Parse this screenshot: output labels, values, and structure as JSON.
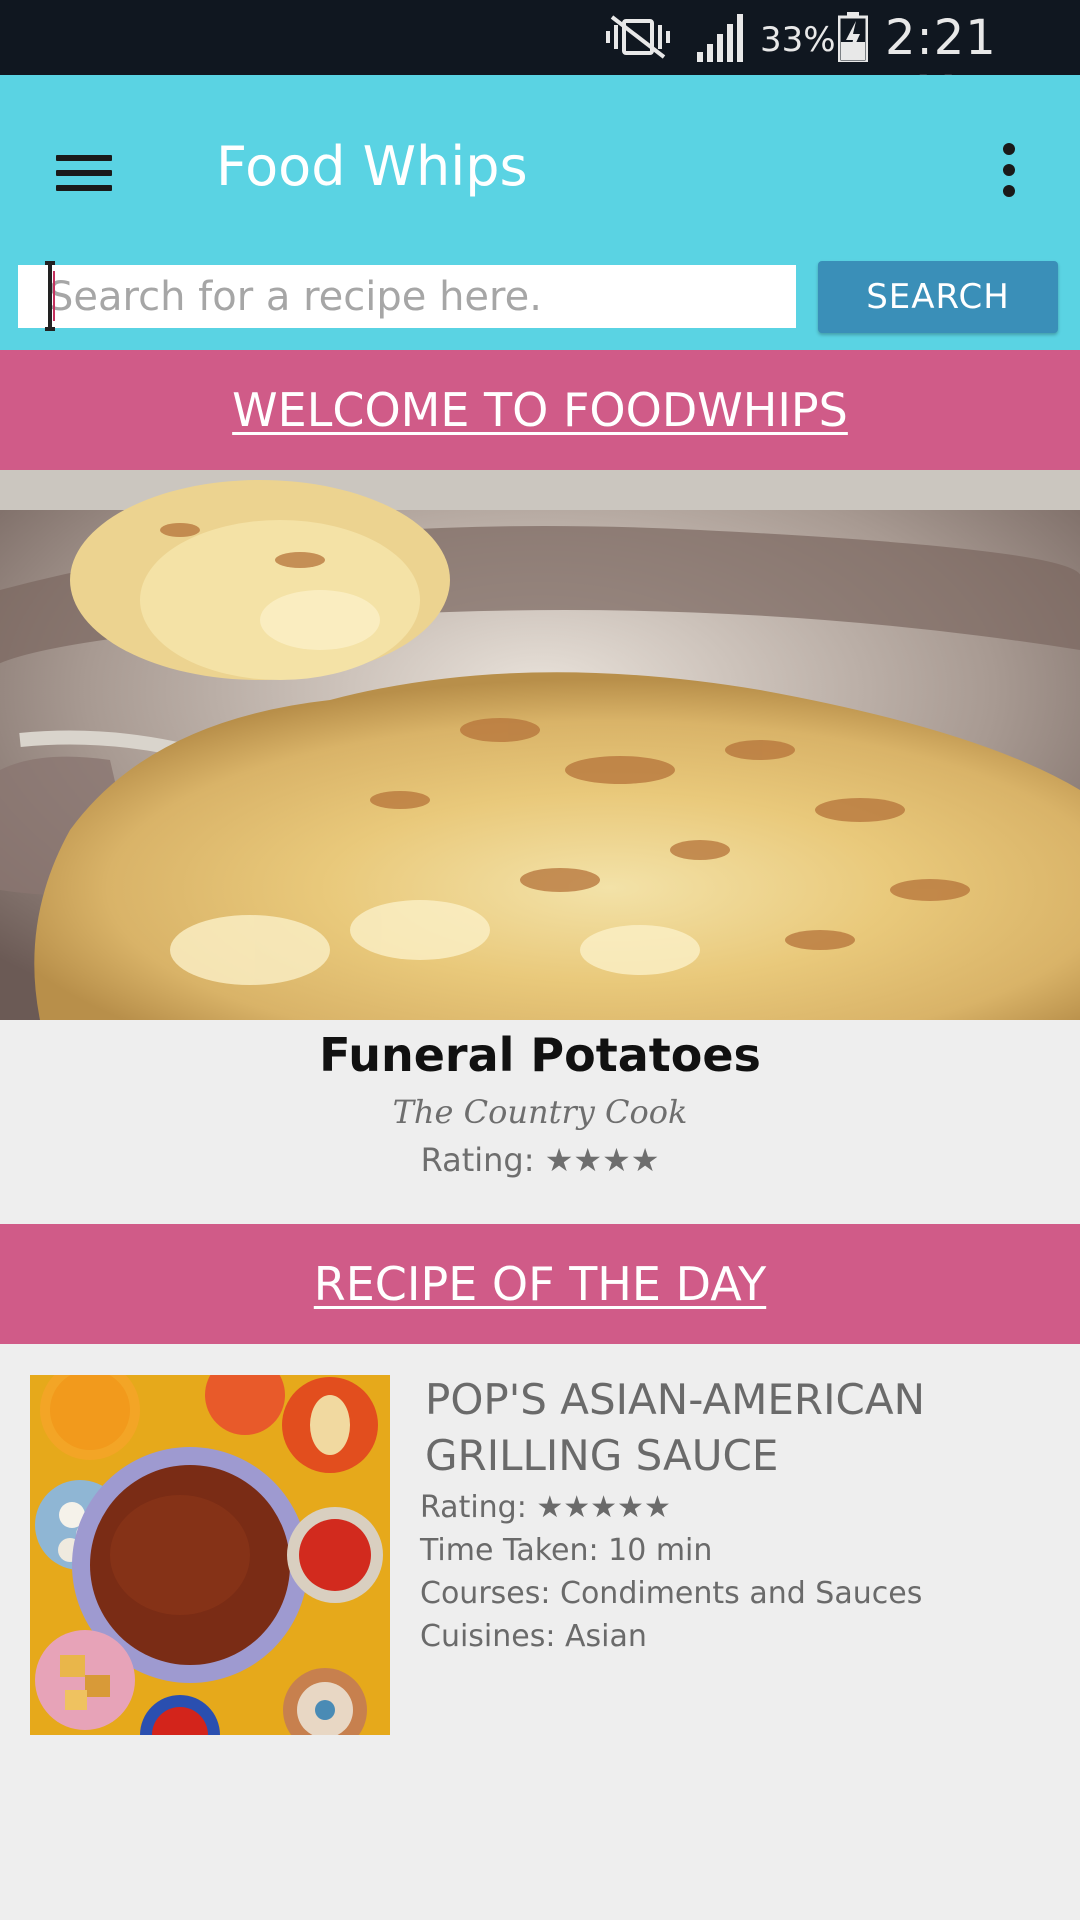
{
  "status_bar": {
    "battery": "33%",
    "time": "2:21 PM"
  },
  "app_bar": {
    "title": "Food Whips",
    "menu_icon": "hamburger-menu-icon",
    "overflow_icon": "more-vert-icon"
  },
  "search": {
    "placeholder": "Search for a recipe here.",
    "value": "",
    "button_label": "SEARCH"
  },
  "welcome": {
    "heading": "WELCOME TO FOODWHIPS"
  },
  "featured": {
    "name": "Funeral Potatoes",
    "author": "The Country Cook",
    "rating_text": "Rating: ★★★★",
    "rating_stars": 4
  },
  "recipe_of_day": {
    "heading": "RECIPE OF THE DAY",
    "title": "POP'S ASIAN-AMERICAN GRILLING SAUCE",
    "rating_text": "Rating: ★★★★★",
    "rating_stars": 5,
    "time_taken": "Time Taken: 10 min",
    "courses": "Courses: Condiments and Sauces",
    "cuisines": "Cuisines: Asian"
  },
  "colors": {
    "status_bar": "#101720",
    "app_bar": "#5ad3e3",
    "section_header": "#d05b88",
    "search_button": "#3a8fb8",
    "background": "#eeeeee"
  }
}
